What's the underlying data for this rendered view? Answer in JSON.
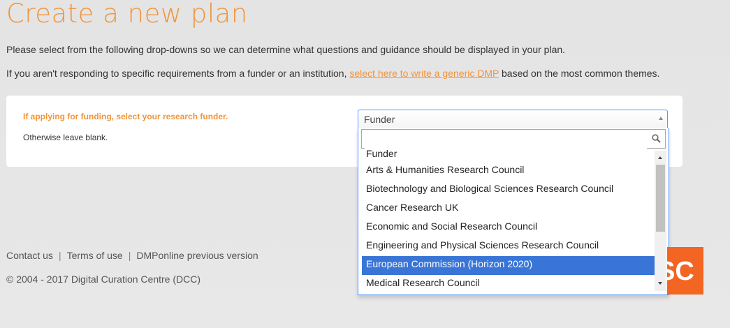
{
  "page": {
    "title": "Create a new plan",
    "intro": "Please select from the following drop-downs so we can determine what questions and guidance should be displayed in your plan.",
    "generic_prefix": "If you aren't responding to specific requirements from a funder or an institution, ",
    "generic_link": "select here to write a generic DMP",
    "generic_suffix": " based on the most common themes."
  },
  "funder_question": {
    "label": "If applying for funding, select your research funder.",
    "hint": "Otherwise leave blank.",
    "selected_value": "Funder",
    "search_value": "",
    "options": [
      "Funder",
      "Arts & Humanities Research Council",
      "Biotechnology and Biological Sciences Research Council",
      "Cancer Research UK",
      "Economic and Social Research Council",
      "Engineering and Physical Sciences Research Council",
      "European Commission (Horizon 2020)",
      "Medical Research Council"
    ],
    "highlighted_index": 6
  },
  "footer": {
    "links": [
      "Contact us",
      "Terms of use",
      "DMPonline previous version"
    ],
    "separator": "|",
    "copyright": "© 2004 - 2017 Digital Curation Centre (DCC)",
    "logo_text": "SC"
  },
  "colors": {
    "accent": "#f1943b",
    "highlight": "#3875d7",
    "logo": "#f26522"
  },
  "icons": [
    "search-icon",
    "arrow-up-icon",
    "scroll-up-icon",
    "scroll-down-icon"
  ]
}
